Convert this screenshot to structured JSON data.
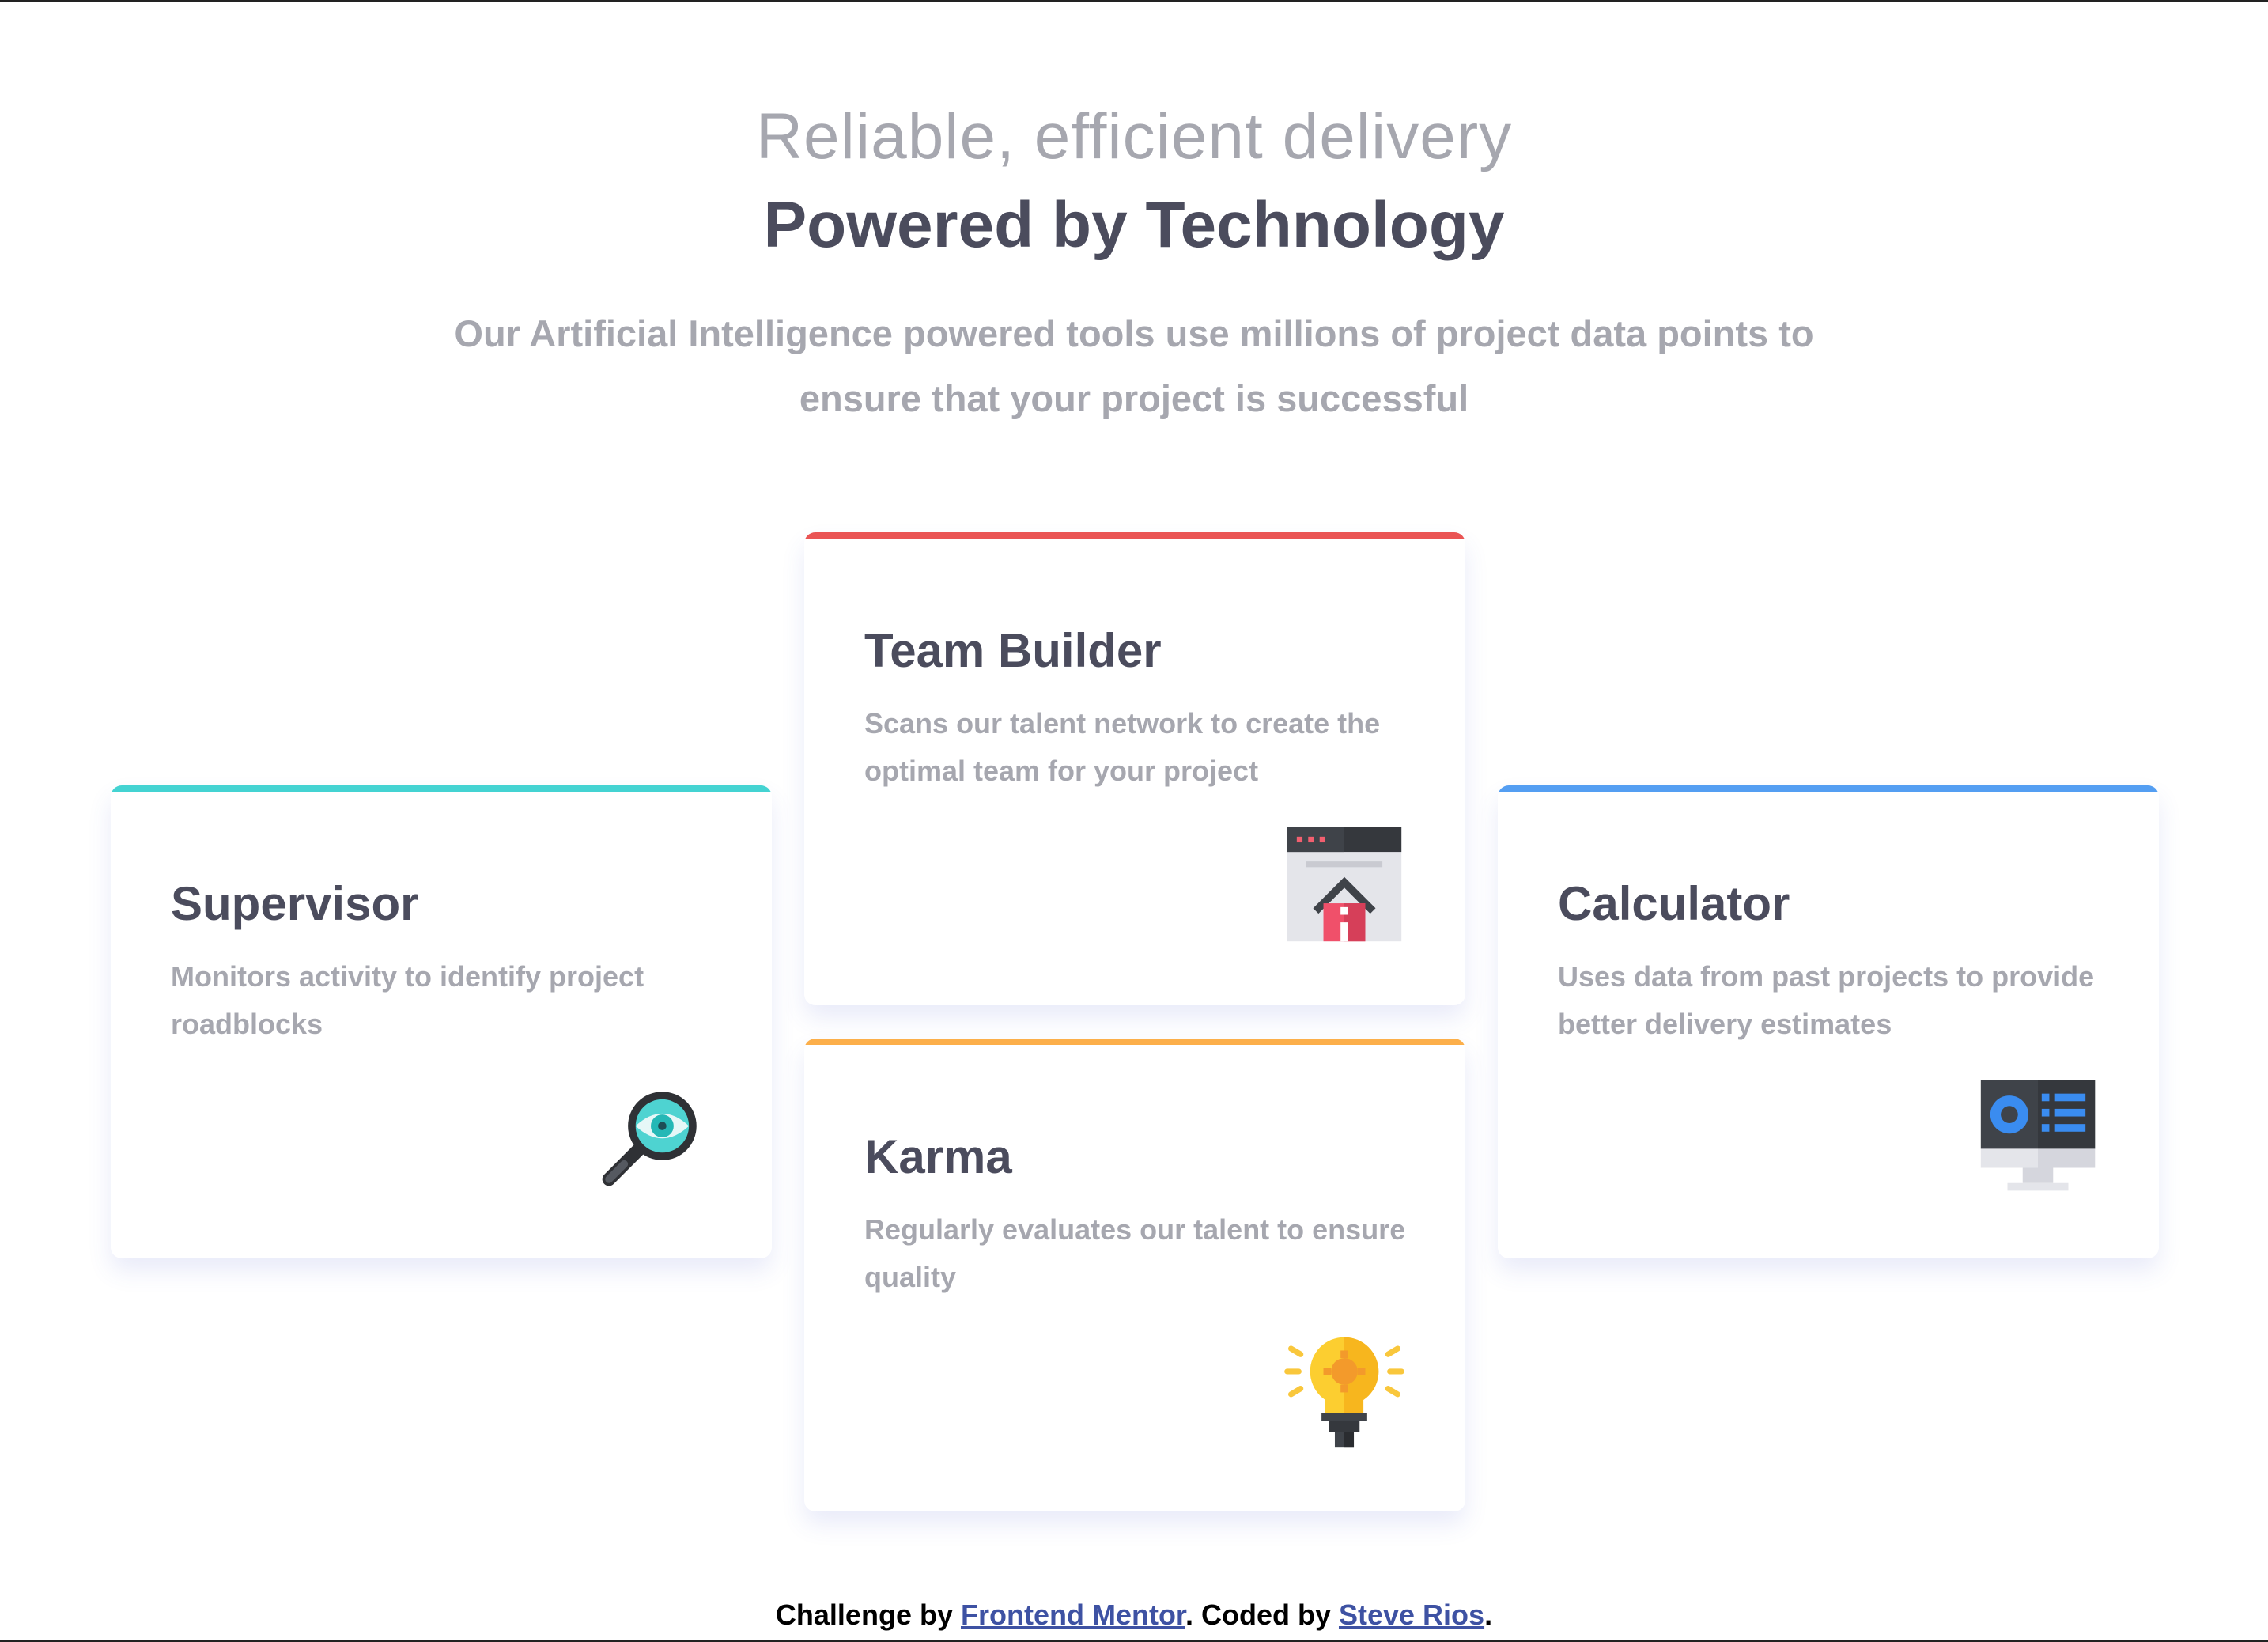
{
  "header": {
    "subtitle": "Reliable, efficient delivery",
    "title": "Powered by Technology",
    "intro": "Our Artificial Intelligence powered tools use millions of project data points to ensure that your project is successful"
  },
  "cards": [
    {
      "title": "Supervisor",
      "description": "Monitors activity to identify project roadblocks",
      "accent": "#44d3d2",
      "icon": "magnifier-eye-icon"
    },
    {
      "title": "Team Builder",
      "description": "Scans our talent network to create the optimal team for your project",
      "accent": "#ea5454",
      "icon": "browser-home-icon"
    },
    {
      "title": "Karma",
      "description": "Regularly evaluates our talent to ensure quality",
      "accent": "#fcaf4a",
      "icon": "lightbulb-icon"
    },
    {
      "title": "Calculator",
      "description": "Uses data from past projects to provide better delivery estimates",
      "accent": "#549ef2",
      "icon": "monitor-chart-icon"
    }
  ],
  "footer": {
    "prefix": "Challenge by ",
    "link1": "Frontend Mentor",
    "middle": ". Coded by ",
    "link2": "Steve Rios",
    "suffix": "."
  }
}
